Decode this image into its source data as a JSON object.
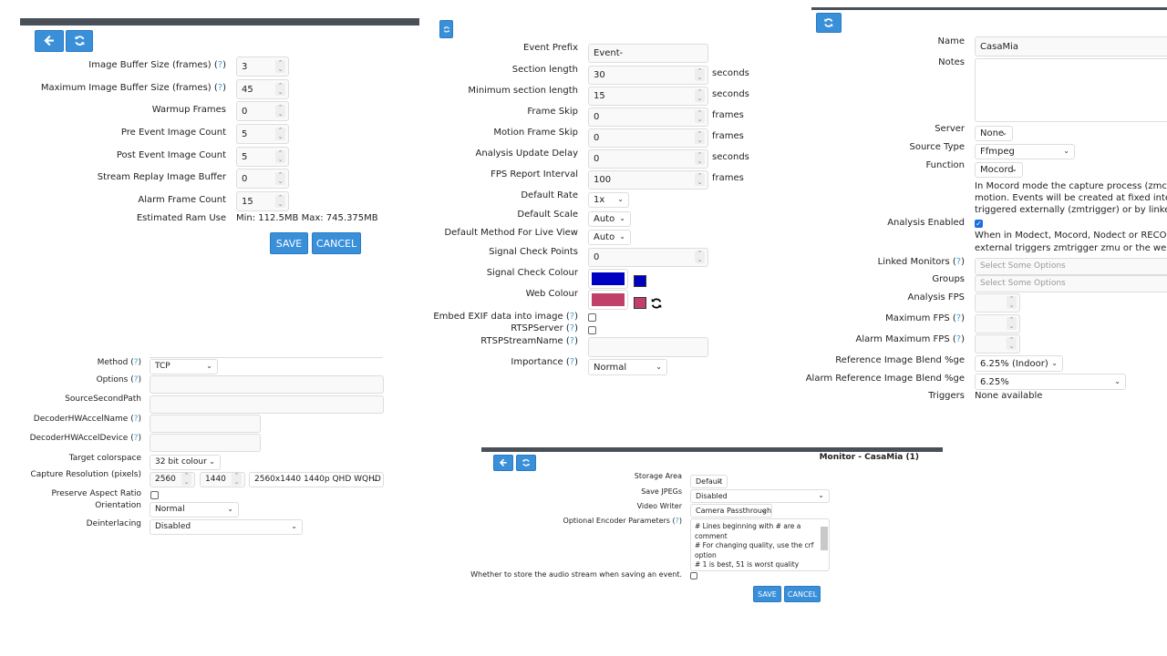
{
  "colors": {
    "accent": "#3a8fd9",
    "bar": "#4a5058",
    "help": "#3aa0e0",
    "signal_check": "#0000c0",
    "web": "#c0406a"
  },
  "icons": {
    "back": "arrow-left-icon",
    "refresh": "refresh-icon",
    "reset_colour": "refresh-icon"
  },
  "buffers": {
    "rows": [
      {
        "label": "Image Buffer Size (frames)",
        "help": "?",
        "value": "3"
      },
      {
        "label": "Maximum Image Buffer Size (frames)",
        "help": "?",
        "value": "45"
      },
      {
        "label": "Warmup Frames",
        "value": "0"
      },
      {
        "label": "Pre Event Image Count",
        "value": "5"
      },
      {
        "label": "Post Event Image Count",
        "value": "5"
      },
      {
        "label": "Stream Replay Image Buffer",
        "value": "0"
      },
      {
        "label": "Alarm Frame Count",
        "value": "15"
      }
    ],
    "ram_label": "Estimated Ram Use",
    "ram_value": "Min: 112.5MB Max: 745.375MB",
    "save": "SAVE",
    "cancel": "CANCEL"
  },
  "source": {
    "method": {
      "label": "Method",
      "help": "?",
      "value": "TCP"
    },
    "options": {
      "label": "Options",
      "help": "?",
      "value": ""
    },
    "second_path": {
      "label": "SourceSecondPath",
      "value": ""
    },
    "hw_name": {
      "label": "DecoderHWAccelName",
      "help": "?",
      "value": ""
    },
    "hw_device": {
      "label": "DecoderHWAccelDevice",
      "help": "?",
      "value": ""
    },
    "colorspace": {
      "label": "Target colorspace",
      "value": "32 bit colour"
    },
    "resolution": {
      "label": "Capture Resolution (pixels)",
      "width": "2560",
      "height": "1440",
      "preset": "2560x1440 1440p QHD WQHD"
    },
    "aspect": {
      "label": "Preserve Aspect Ratio",
      "checked": false
    },
    "orientation": {
      "label": "Orientation",
      "value": "Normal"
    },
    "deinterlacing": {
      "label": "Deinterlacing",
      "value": "Disabled"
    }
  },
  "misc": {
    "event_prefix": {
      "label": "Event Prefix",
      "value": "Event-"
    },
    "section_length": {
      "label": "Section length",
      "value": "30",
      "unit": "seconds"
    },
    "min_section": {
      "label": "Minimum section length",
      "value": "15",
      "unit": "seconds"
    },
    "frame_skip": {
      "label": "Frame Skip",
      "value": "0",
      "unit": "frames"
    },
    "motion_skip": {
      "label": "Motion Frame Skip",
      "value": "0",
      "unit": "frames"
    },
    "analysis_delay": {
      "label": "Analysis Update Delay",
      "value": "0",
      "unit": "seconds"
    },
    "fps_interval": {
      "label": "FPS Report Interval",
      "value": "100",
      "unit": "frames"
    },
    "default_rate": {
      "label": "Default Rate",
      "value": "1x"
    },
    "default_scale": {
      "label": "Default Scale",
      "value": "Auto"
    },
    "default_method": {
      "label": "Default Method For Live View",
      "value": "Auto"
    },
    "signal_points": {
      "label": "Signal Check Points",
      "value": "0"
    },
    "signal_colour": {
      "label": "Signal Check Colour"
    },
    "web_colour": {
      "label": "Web Colour"
    },
    "exif": {
      "label": "Embed EXIF data into image",
      "help": "?",
      "checked": false
    },
    "rtsp_server": {
      "label": "RTSPServer",
      "help": "?",
      "checked": false
    },
    "rtsp_name": {
      "label": "RTSPStreamName",
      "help": "?",
      "value": ""
    },
    "importance": {
      "label": "Importance",
      "help": "?",
      "value": "Normal"
    }
  },
  "general": {
    "name": {
      "label": "Name",
      "value": "CasaMia"
    },
    "notes": {
      "label": "Notes",
      "value": ""
    },
    "server": {
      "label": "Server",
      "value": "None"
    },
    "source_type": {
      "label": "Source Type",
      "value": "Ffmpeg"
    },
    "function": {
      "label": "Function",
      "value": "Mocord"
    },
    "function_help": [
      "In Mocord mode the capture process (zmc) will c",
      "motion. Events will be created at fixed intervals",
      "triggered externally (zmtrigger) or by linked mo"
    ],
    "analysis_enabled": {
      "label": "Analysis Enabled",
      "checked": true
    },
    "analysis_help": [
      "When in Modect, Mocord, Nodect or RECORD m",
      "external triggers zmtrigger zmu or the web ui. V"
    ],
    "linked": {
      "label": "Linked Monitors",
      "help": "?",
      "placeholder": "Select Some Options"
    },
    "groups": {
      "label": "Groups",
      "placeholder": "Select Some Options"
    },
    "analysis_fps": {
      "label": "Analysis FPS",
      "value": ""
    },
    "max_fps": {
      "label": "Maximum FPS",
      "help": "?",
      "value": ""
    },
    "alarm_max_fps": {
      "label": "Alarm Maximum FPS",
      "help": "?",
      "value": ""
    },
    "ref_blend": {
      "label": "Reference Image Blend %ge",
      "value": "6.25% (Indoor)"
    },
    "alarm_ref_blend": {
      "label": "Alarm Reference Image Blend %ge",
      "value": "6.25%"
    },
    "triggers": {
      "label": "Triggers",
      "value": "None available"
    }
  },
  "storage": {
    "title": "Monitor - CasaMia (1)",
    "storage_area": {
      "label": "Storage Area",
      "value": "Default"
    },
    "save_jpegs": {
      "label": "Save JPEGs",
      "value": "Disabled"
    },
    "video_writer": {
      "label": "Video Writer",
      "value": "Camera Passthrough"
    },
    "encoder": {
      "label": "Optional Encoder Parameters",
      "help": "?",
      "lines": [
        "# Lines beginning with # are a",
        "comment",
        "# For changing quality, use the crf",
        "option",
        "# 1 is best, 51 is worst quality"
      ]
    },
    "audio": {
      "label": "Whether to store the audio stream when saving an event.",
      "checked": false
    },
    "save": "SAVE",
    "cancel": "CANCEL"
  }
}
